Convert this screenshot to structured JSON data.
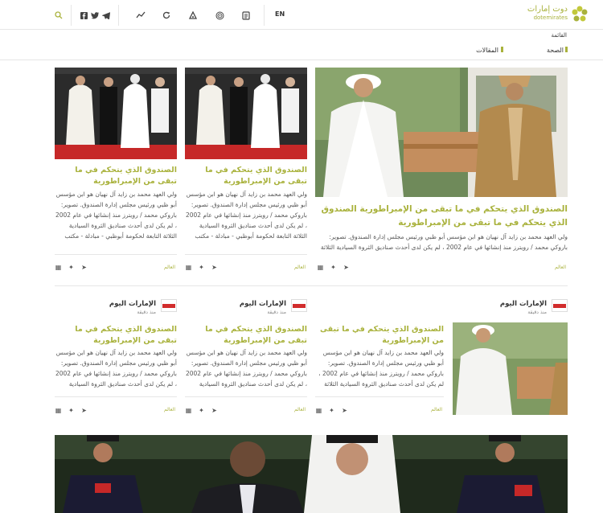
{
  "header": {
    "logo_ar": "دوت إمارات",
    "logo_en": "dotemirates",
    "lang": "EN",
    "icons": [
      "search-icon",
      "facebook-icon",
      "twitter-icon",
      "telegram-icon",
      "trend-icon",
      "refresh-icon",
      "bell-icon",
      "fingerprint-icon",
      "document-icon"
    ]
  },
  "nav": {
    "menu": "القائمة",
    "categories": [
      "الصحة",
      "المقالات"
    ]
  },
  "featured": {
    "title": "الصندوق الذي يتحكم في ما تبقى من الإمبراطورية الصندوق الذي يتحكم في ما تبقى من الإمبراطورية",
    "body": "ولي العهد محمد بن زايد آل نهيان هو ابن مؤسس أبو ظبي ورئيس مجلس إدارة الصندوق. تصوير: باروكي محمد / رويترز منذ إنشائها في عام 2002 ، لم يكن لدى أحدث صناديق الثروة السيادية الثلاثة التابعة لحكومة",
    "category": "العالم"
  },
  "top_cards": [
    {
      "title": "الصندوق الذي يتحكم في ما تبقى من الإمبراطورية",
      "body": "ولي العهد محمد بن زايد آل نهيان هو ابن مؤسس أبو ظبي ورئيس مجلس إدارة الصندوق. تصوير: باروكي محمد / رويترز منذ إنشائها في عام 2002 ، لم يكن لدى أحدث صناديق الثروة السيادية الثلاثة التابعة لحكومة أبوظبي - مبادلة - مكتب خارج الأراضي",
      "category": "العالم"
    },
    {
      "title": "الصندوق الذي يتحكم في ما تبقى من الإمبراطورية",
      "body": "ولي العهد محمد بن زايد آل نهيان هو ابن مؤسس أبو ظبي ورئيس مجلس إدارة الصندوق. تصوير: باروكي محمد / رويترز منذ إنشائها في عام 2002 ، لم يكن لدى أحدث صناديق الثروة السيادية الثلاثة التابعة لحكومة أبوظبي - مبادلة - مكتب خارج الأراضي",
      "category": "العالم"
    }
  ],
  "bottom_cards": [
    {
      "source": "الإمارات اليوم",
      "time": "منذ دقيقة",
      "title": "الصندوق الذي يتحكم في ما تبقى من الإمبراطورية",
      "body": "ولي العهد محمد بن زايد آل نهيان هو ابن مؤسس أبو ظبي ورئيس مجلس إدارة الصندوق. تصوير: باروكي محمد / رويترز منذ إنشائها في عام 2002 ، لم يكن لدى أحدث صناديق الثروة السيادية الثلاثة التابعة لحكومة",
      "category": "العالم"
    },
    {
      "source": "الإمارات اليوم",
      "time": "منذ دقيقة",
      "title": "الصندوق الذي يتحكم في ما تبقى من الإمبراطورية",
      "body": "ولي العهد محمد بن زايد آل نهيان هو ابن مؤسس أبو ظبي ورئيس مجلس إدارة الصندوق. تصوير: باروكي محمد / رويترز منذ إنشائها في عام 2002 ، لم يكن لدى أحدث صناديق الثروة السيادية الثلاثة التابعة",
      "category": "العالم"
    },
    {
      "source": "الإمارات اليوم",
      "time": "منذ دقيقة",
      "title": "الصندوق الذي يتحكم في ما تبقى من الإمبراطورية",
      "body": "ولي العهد محمد بن زايد آل نهيان هو ابن مؤسس أبو ظبي ورئيس مجلس إدارة الصندوق. تصوير: باروكي محمد / رويترز منذ إنشائها في عام 2002 ، لم يكن لدى أحدث صناديق الثروة السيادية الثلاثة التابعة",
      "category": "العالم"
    }
  ],
  "colors": {
    "accent": "#a9b23c",
    "red_carpet": "#c62828"
  }
}
